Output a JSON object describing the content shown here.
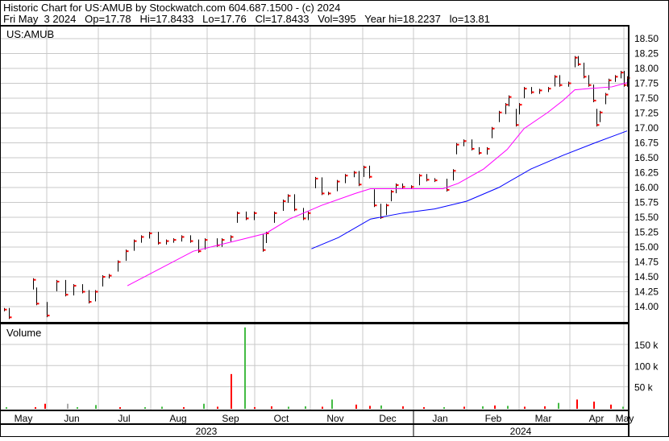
{
  "header": {
    "line1": "Historic Chart for US:AMUB by Stockwatch.com 604.687.1500 - (c) 2024",
    "line2": "Fri May  3 2024   Op=17.78   Hi=17.8433   Lo=17.76   Cl=17.8433   Vol=395   Year hi=18.2237   lo=13.81"
  },
  "chart_data": {
    "type": "line",
    "symbol_label": "US:AMUB",
    "volume_label": "Volume",
    "x_unit": "trading-day offset from late Apr 2023",
    "xlim": [
      0,
      371
    ],
    "price_ylim": [
      13.8,
      18.6
    ],
    "price_ticks": [
      "14.00",
      "14.25",
      "14.50",
      "14.75",
      "15.00",
      "15.25",
      "15.50",
      "15.75",
      "16.00",
      "16.25",
      "16.50",
      "16.75",
      "17.00",
      "17.25",
      "17.50",
      "17.75",
      "18.00",
      "18.25",
      "18.50"
    ],
    "volume_ticks": [
      {
        "label": "50 k",
        "value": 50000
      },
      {
        "label": "100 k",
        "value": 100000
      },
      {
        "label": "150 k",
        "value": 150000
      }
    ],
    "months": [
      "May",
      "Jun",
      "Jul",
      "Aug",
      "Sep",
      "Oct",
      "Nov",
      "Dec",
      "Jan",
      "Feb",
      "Mar",
      "Apr",
      "May"
    ],
    "years": [
      "2023",
      "2024"
    ],
    "colors": {
      "price_bar": "#000000",
      "close_tick": "#ff0000",
      "ma_short": "#ff00ff",
      "ma_long": "#0000ff",
      "vol_up": "#44bb44",
      "vol_down": "#ff0000",
      "vol_flat": "#aaaaaa",
      "grid": "#c8c8c8"
    },
    "prices": [
      [
        2,
        13.95
      ],
      [
        5,
        13.82
      ],
      [
        19,
        14.45
      ],
      [
        21,
        14.05
      ],
      [
        27,
        13.85
      ],
      [
        33,
        14.42
      ],
      [
        38,
        14.2
      ],
      [
        43,
        14.35
      ],
      [
        48,
        14.25
      ],
      [
        52,
        14.08
      ],
      [
        56,
        14.25
      ],
      [
        60,
        14.5
      ],
      [
        64,
        14.52
      ],
      [
        69,
        14.75
      ],
      [
        74,
        14.93
      ],
      [
        79,
        15.1
      ],
      [
        83,
        15.17
      ],
      [
        88,
        15.23
      ],
      [
        93,
        15.07
      ],
      [
        98,
        15.1
      ],
      [
        102,
        15.12
      ],
      [
        107,
        15.17
      ],
      [
        112,
        15.1
      ],
      [
        117,
        14.93
      ],
      [
        121,
        15.12
      ],
      [
        128,
        15.03
      ],
      [
        131,
        15.12
      ],
      [
        136,
        15.17
      ],
      [
        140,
        15.57
      ],
      [
        145,
        15.48
      ],
      [
        150,
        15.57
      ],
      [
        155,
        14.95
      ],
      [
        157,
        15.23
      ],
      [
        162,
        15.57
      ],
      [
        167,
        15.77
      ],
      [
        170,
        15.86
      ],
      [
        174,
        15.63
      ],
      [
        179,
        15.48
      ],
      [
        182,
        15.57
      ],
      [
        186,
        16.15
      ],
      [
        190,
        15.9
      ],
      [
        194,
        15.9
      ],
      [
        199,
        16.1
      ],
      [
        204,
        16.2
      ],
      [
        209,
        16.25
      ],
      [
        212,
        16.05
      ],
      [
        215,
        16.34
      ],
      [
        218,
        16.18
      ],
      [
        221,
        15.7
      ],
      [
        225,
        15.5
      ],
      [
        228,
        15.7
      ],
      [
        231,
        15.93
      ],
      [
        234,
        16.04
      ],
      [
        238,
        16.01
      ],
      [
        243,
        16.01
      ],
      [
        248,
        16.2
      ],
      [
        252,
        16.13
      ],
      [
        257,
        16.12
      ],
      [
        264,
        15.96
      ],
      [
        268,
        16.28
      ],
      [
        270,
        16.72
      ],
      [
        274,
        16.78
      ],
      [
        279,
        16.65
      ],
      [
        283,
        16.58
      ],
      [
        288,
        16.65
      ],
      [
        291,
        16.99
      ],
      [
        295,
        17.26
      ],
      [
        299,
        17.39
      ],
      [
        301,
        17.52
      ],
      [
        305,
        17.05
      ],
      [
        307,
        17.39
      ],
      [
        310,
        17.66
      ],
      [
        314,
        17.6
      ],
      [
        319,
        17.63
      ],
      [
        324,
        17.66
      ],
      [
        328,
        17.86
      ],
      [
        331,
        17.72
      ],
      [
        336,
        17.75
      ],
      [
        340,
        18.18
      ],
      [
        342,
        18.07
      ],
      [
        345,
        17.86
      ],
      [
        348,
        17.72
      ],
      [
        351,
        17.46
      ],
      [
        353,
        17.05
      ],
      [
        355,
        17.26
      ],
      [
        358,
        17.56
      ],
      [
        360,
        17.8
      ],
      [
        364,
        17.86
      ],
      [
        367,
        17.93
      ],
      [
        369,
        17.72
      ],
      [
        371,
        17.84
      ]
    ],
    "ma_short": [
      [
        75,
        14.35
      ],
      [
        114,
        14.93
      ],
      [
        143,
        15.13
      ],
      [
        157,
        15.23
      ],
      [
        171,
        15.47
      ],
      [
        190,
        15.7
      ],
      [
        210,
        15.9
      ],
      [
        219,
        15.98
      ],
      [
        238,
        15.98
      ],
      [
        262,
        15.98
      ],
      [
        271,
        16.07
      ],
      [
        286,
        16.31
      ],
      [
        300,
        16.64
      ],
      [
        310,
        16.99
      ],
      [
        324,
        17.26
      ],
      [
        333,
        17.46
      ],
      [
        340,
        17.64
      ],
      [
        348,
        17.66
      ],
      [
        362,
        17.69
      ],
      [
        371,
        17.76
      ]
    ],
    "ma_long": [
      [
        184,
        14.97
      ],
      [
        200,
        15.16
      ],
      [
        219,
        15.47
      ],
      [
        238,
        15.57
      ],
      [
        257,
        15.64
      ],
      [
        276,
        15.77
      ],
      [
        295,
        16.0
      ],
      [
        314,
        16.31
      ],
      [
        333,
        16.54
      ],
      [
        352,
        16.75
      ],
      [
        371,
        16.95
      ]
    ],
    "volume": [
      [
        3,
        2000,
        "up"
      ],
      [
        20,
        2000,
        "down"
      ],
      [
        26,
        10000,
        "down"
      ],
      [
        39,
        10000,
        "flat"
      ],
      [
        45,
        2000,
        "up"
      ],
      [
        56,
        7000,
        "up"
      ],
      [
        70,
        2000,
        "down"
      ],
      [
        85,
        2000,
        "up"
      ],
      [
        95,
        3000,
        "up"
      ],
      [
        108,
        2000,
        "down"
      ],
      [
        120,
        2000,
        "up"
      ],
      [
        128,
        3000,
        "down"
      ],
      [
        136,
        80000,
        "down"
      ],
      [
        120,
        10000,
        "up"
      ],
      [
        144,
        190000,
        "up"
      ],
      [
        150,
        2000,
        "down"
      ],
      [
        160,
        4000,
        "down"
      ],
      [
        170,
        3000,
        "up"
      ],
      [
        180,
        4000,
        "up"
      ],
      [
        190,
        3000,
        "down"
      ],
      [
        196,
        20000,
        "up"
      ],
      [
        210,
        8000,
        "down"
      ],
      [
        218,
        5000,
        "down"
      ],
      [
        225,
        6000,
        "up"
      ],
      [
        238,
        4000,
        "down"
      ],
      [
        250,
        2000,
        "down"
      ],
      [
        262,
        2000,
        "up"
      ],
      [
        274,
        3000,
        "down"
      ],
      [
        285,
        4000,
        "up"
      ],
      [
        292,
        6000,
        "down"
      ],
      [
        300,
        5000,
        "up"
      ],
      [
        310,
        3000,
        "down"
      ],
      [
        322,
        4000,
        "down"
      ],
      [
        330,
        12000,
        "up"
      ],
      [
        341,
        20000,
        "down"
      ],
      [
        351,
        15000,
        "down"
      ],
      [
        361,
        8000,
        "down"
      ],
      [
        368,
        3000,
        "up"
      ]
    ]
  }
}
